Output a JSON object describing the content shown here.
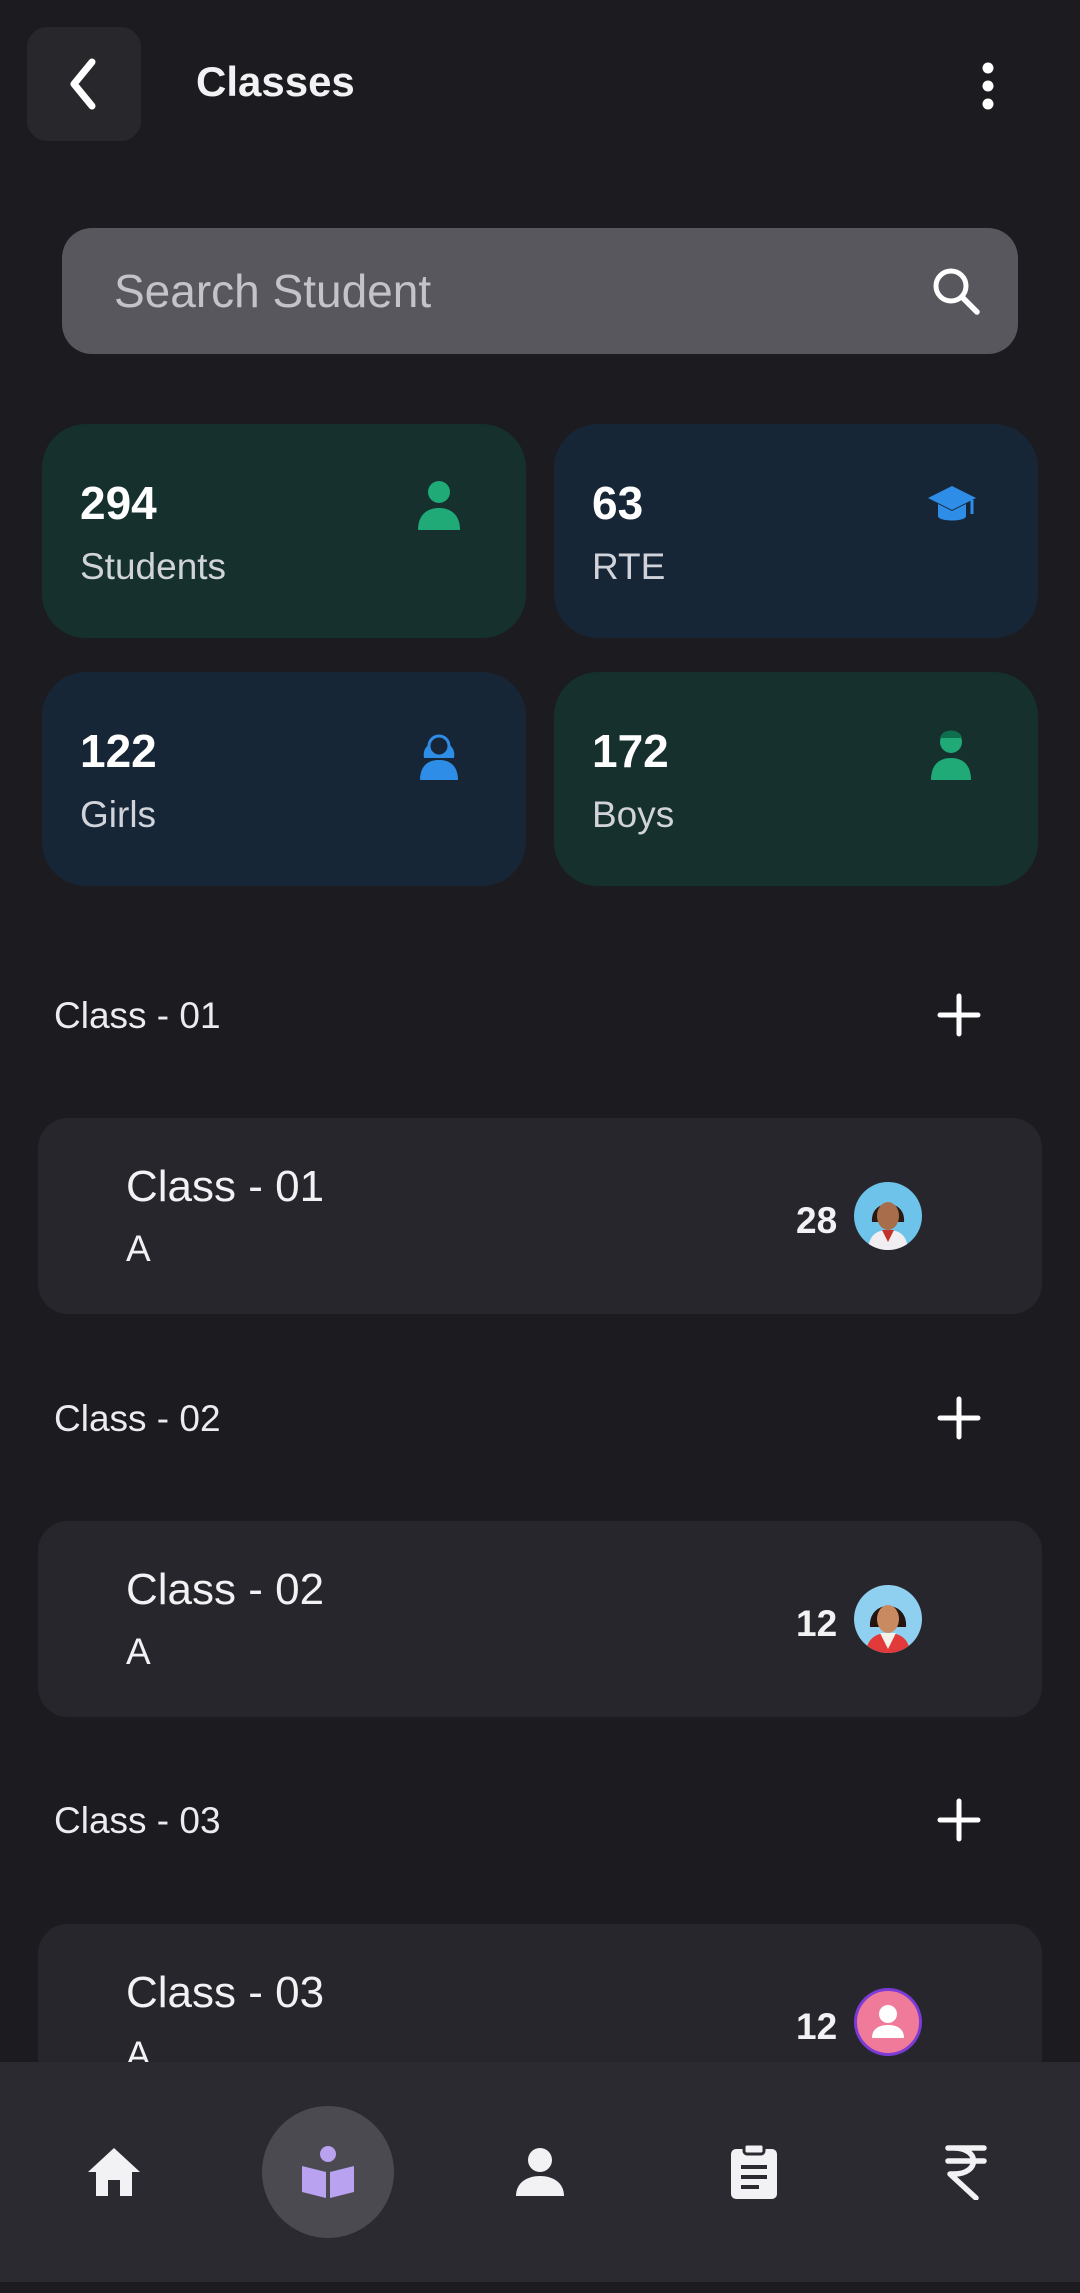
{
  "header": {
    "title": "Classes",
    "back_icon": "chevron-left-icon",
    "more_icon": "more-vertical-icon"
  },
  "search": {
    "placeholder": "Search Student",
    "value": "",
    "icon": "search-icon"
  },
  "stats": [
    {
      "value": "294",
      "label": "Students",
      "icon": "person-icon",
      "color": "#1faa78"
    },
    {
      "value": "63",
      "label": "RTE",
      "icon": "graduation-cap-icon",
      "color": "#2e8de6"
    },
    {
      "value": "122",
      "label": "Girls",
      "icon": "girl-icon",
      "color": "#2e8de6"
    },
    {
      "value": "172",
      "label": "Boys",
      "icon": "boy-icon",
      "color": "#1faa78"
    }
  ],
  "sections": [
    {
      "label": "Class - 01",
      "card": {
        "name": "Class - 01",
        "section": "A",
        "count": "28"
      }
    },
    {
      "label": "Class - 02",
      "card": {
        "name": "Class - 02",
        "section": "A",
        "count": "12"
      }
    },
    {
      "label": "Class - 03",
      "card": {
        "name": "Class - 03",
        "section": "A",
        "count": "12"
      }
    }
  ],
  "bottom_nav": {
    "items": [
      {
        "icon": "home-icon",
        "active": false
      },
      {
        "icon": "classes-book-icon",
        "active": true
      },
      {
        "icon": "profile-icon",
        "active": false
      },
      {
        "icon": "clipboard-icon",
        "active": false
      },
      {
        "icon": "rupee-icon",
        "active": false
      }
    ]
  },
  "colors": {
    "background": "#1b1b20",
    "card": "#26262c",
    "accent_green": "#1faa78",
    "accent_blue": "#2e8de6",
    "active_nav": "#b9a2f0"
  }
}
